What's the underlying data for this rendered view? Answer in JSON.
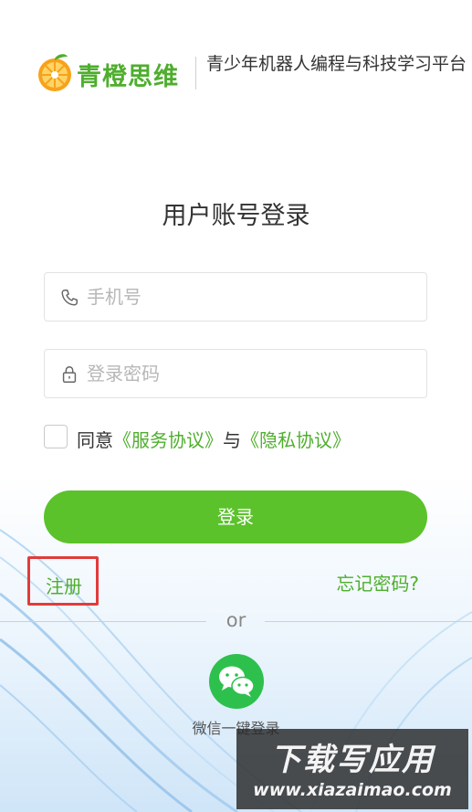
{
  "header": {
    "logo_text": "青橙思维",
    "tagline": "青少年机器人编程与科技学习平台"
  },
  "login": {
    "title": "用户账号登录",
    "phone_placeholder": "手机号",
    "password_placeholder": "登录密码",
    "agree_prefix": "同意",
    "service_link": "《服务协议》",
    "agree_and": "与",
    "privacy_link": "《隐私协议》",
    "login_button": "登录",
    "register_link": "注册",
    "forgot_link": "忘记密码?",
    "or_text": "or",
    "wechat_label": "微信一键登录"
  },
  "watermark": {
    "title": "下载写应用",
    "url": "www.xiazaimao.com"
  },
  "colors": {
    "brand_green": "#5bc22c",
    "link_green": "#4fae2e",
    "highlight_red": "#e23b3b"
  },
  "icons": [
    "orange-logo-icon",
    "phone-icon",
    "lock-icon",
    "wechat-icon"
  ]
}
